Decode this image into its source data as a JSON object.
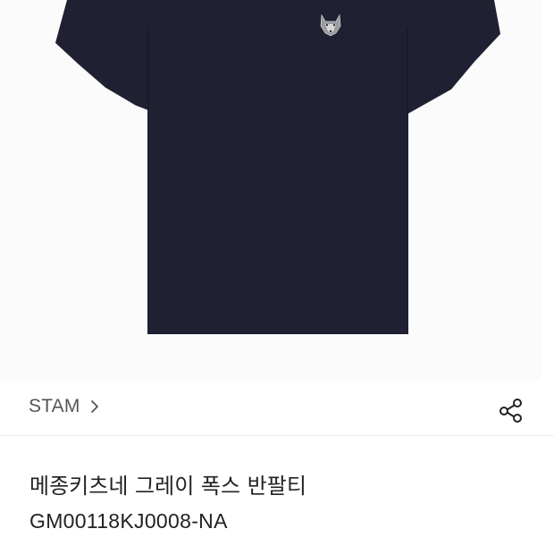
{
  "product": {
    "image_alt_icon": "tshirt-image",
    "logo_icon": "fox-head-patch-icon",
    "seller": "STAM",
    "seller_chevron_icon": "chevron-right-icon",
    "share_icon": "share-icon",
    "title": "메종키츠네 그레이 폭스 반팔티",
    "model_code": "GM00118KJ0008-NA"
  },
  "colors": {
    "shirt": "#1f2032",
    "image_bg": "#fbfbfb",
    "divider": "#ededed",
    "text_primary": "#222222",
    "text_secondary": "#555555"
  }
}
